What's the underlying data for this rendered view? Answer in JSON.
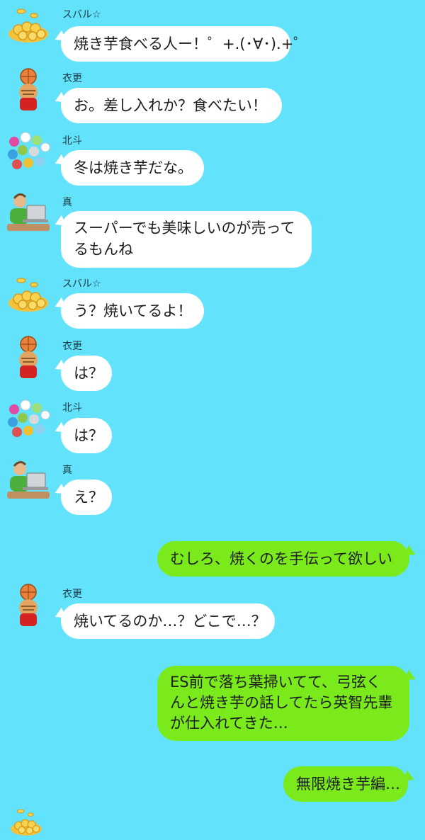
{
  "messages": [
    {
      "sender": "スバル☆",
      "avatar": "gold-coins-icon",
      "text": "焼き芋食べる人ー！゜+.(･∀･).+゜",
      "side": "in"
    },
    {
      "sender": "衣更",
      "avatar": "basketball-cat-icon",
      "text": "お。差し入れか？食べたい！",
      "side": "in"
    },
    {
      "sender": "北斗",
      "avatar": "colorful-flowers-icon",
      "text": "冬は焼き芋だな。",
      "side": "in"
    },
    {
      "sender": "真",
      "avatar": "laptop-person-icon",
      "text_line1": "スーパーでも美味しいのが売って",
      "text_line2": "るもんね",
      "side": "in"
    },
    {
      "sender": "スバル☆",
      "avatar": "gold-coins-icon",
      "text": "う？焼いてるよ！",
      "side": "in"
    },
    {
      "sender": "衣更",
      "avatar": "basketball-cat-icon",
      "text": "は？",
      "side": "in"
    },
    {
      "sender": "北斗",
      "avatar": "colorful-flowers-icon",
      "text": "は？",
      "side": "in"
    },
    {
      "sender": "真",
      "avatar": "laptop-person-icon",
      "text": "え？",
      "side": "in"
    },
    {
      "text": "むしろ、焼くのを手伝って欲しい",
      "side": "out"
    },
    {
      "sender": "衣更",
      "avatar": "basketball-cat-icon",
      "text": "焼いてるのか…？どこで…？",
      "side": "in"
    },
    {
      "text_line1": "ES前で落ち葉掃いてて、弓弦く",
      "text_line2": "んと焼き芋の話してたら英智先輩",
      "text_line3": "が仕入れてきた…",
      "side": "out"
    },
    {
      "text": "無限焼き芋編…",
      "side": "out"
    }
  ],
  "colors": {
    "background": "#63e2fb",
    "incoming_bubble": "#ffffff",
    "outgoing_bubble": "#7bea1c"
  }
}
